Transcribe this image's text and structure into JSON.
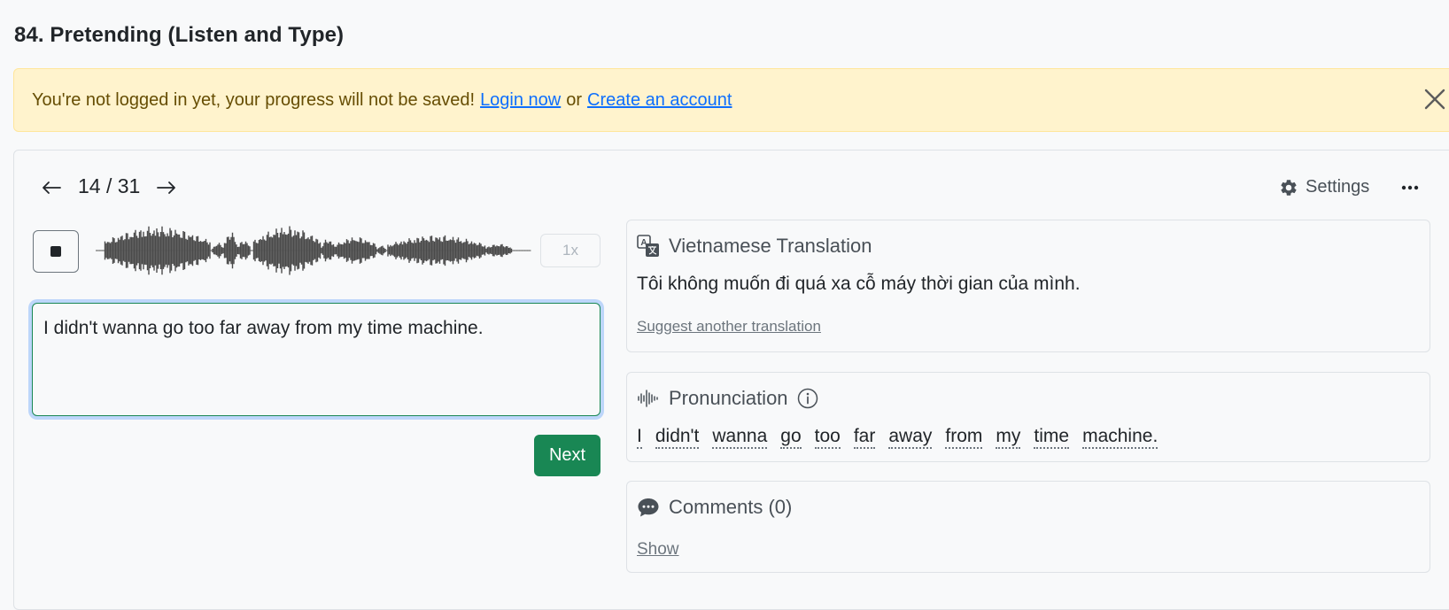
{
  "page": {
    "title": "84. Pretending (Listen and Type)"
  },
  "alert": {
    "message": "You're not logged in yet, your progress will not be saved!",
    "login_label": "Login now",
    "or_label": "or",
    "create_label": "Create an account"
  },
  "nav": {
    "counter": "14 / 31",
    "current": 14,
    "total": 31
  },
  "toolbar": {
    "settings_label": "Settings"
  },
  "player": {
    "speed_label": "1x"
  },
  "answer": {
    "value": "I didn't wanna go too far away from my time machine."
  },
  "actions": {
    "next_label": "Next"
  },
  "translation": {
    "heading": "Vietnamese Translation",
    "text": "Tôi không muốn đi quá xa cỗ máy thời gian của mình.",
    "suggest_label": "Suggest another translation"
  },
  "pronunciation": {
    "heading": "Pronunciation",
    "words": [
      "I",
      "didn't",
      "wanna",
      "go",
      "too",
      "far",
      "away",
      "from",
      "my",
      "time",
      "machine."
    ]
  },
  "comments": {
    "heading": "Comments (0)",
    "show_label": "Show"
  },
  "colors": {
    "success": "#198754",
    "alert_bg": "#fff3cd",
    "link": "#0d6efd"
  }
}
